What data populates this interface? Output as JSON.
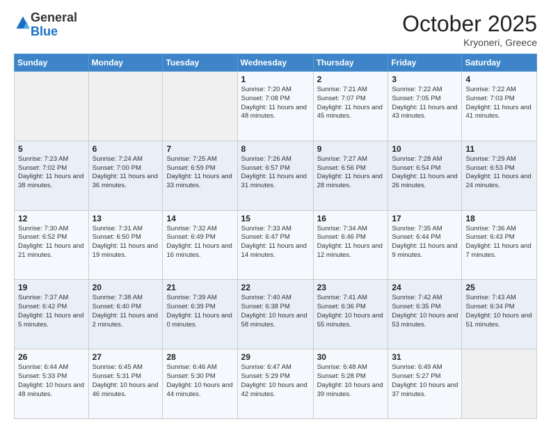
{
  "logo": {
    "general": "General",
    "blue": "Blue"
  },
  "header": {
    "month": "October 2025",
    "location": "Kryoneri, Greece"
  },
  "days_of_week": [
    "Sunday",
    "Monday",
    "Tuesday",
    "Wednesday",
    "Thursday",
    "Friday",
    "Saturday"
  ],
  "weeks": [
    [
      {
        "day": "",
        "info": ""
      },
      {
        "day": "",
        "info": ""
      },
      {
        "day": "",
        "info": ""
      },
      {
        "day": "1",
        "info": "Sunrise: 7:20 AM\nSunset: 7:08 PM\nDaylight: 11 hours\nand 48 minutes."
      },
      {
        "day": "2",
        "info": "Sunrise: 7:21 AM\nSunset: 7:07 PM\nDaylight: 11 hours\nand 45 minutes."
      },
      {
        "day": "3",
        "info": "Sunrise: 7:22 AM\nSunset: 7:05 PM\nDaylight: 11 hours\nand 43 minutes."
      },
      {
        "day": "4",
        "info": "Sunrise: 7:22 AM\nSunset: 7:03 PM\nDaylight: 11 hours\nand 41 minutes."
      }
    ],
    [
      {
        "day": "5",
        "info": "Sunrise: 7:23 AM\nSunset: 7:02 PM\nDaylight: 11 hours\nand 38 minutes."
      },
      {
        "day": "6",
        "info": "Sunrise: 7:24 AM\nSunset: 7:00 PM\nDaylight: 11 hours\nand 36 minutes."
      },
      {
        "day": "7",
        "info": "Sunrise: 7:25 AM\nSunset: 6:59 PM\nDaylight: 11 hours\nand 33 minutes."
      },
      {
        "day": "8",
        "info": "Sunrise: 7:26 AM\nSunset: 6:57 PM\nDaylight: 11 hours\nand 31 minutes."
      },
      {
        "day": "9",
        "info": "Sunrise: 7:27 AM\nSunset: 6:56 PM\nDaylight: 11 hours\nand 28 minutes."
      },
      {
        "day": "10",
        "info": "Sunrise: 7:28 AM\nSunset: 6:54 PM\nDaylight: 11 hours\nand 26 minutes."
      },
      {
        "day": "11",
        "info": "Sunrise: 7:29 AM\nSunset: 6:53 PM\nDaylight: 11 hours\nand 24 minutes."
      }
    ],
    [
      {
        "day": "12",
        "info": "Sunrise: 7:30 AM\nSunset: 6:52 PM\nDaylight: 11 hours\nand 21 minutes."
      },
      {
        "day": "13",
        "info": "Sunrise: 7:31 AM\nSunset: 6:50 PM\nDaylight: 11 hours\nand 19 minutes."
      },
      {
        "day": "14",
        "info": "Sunrise: 7:32 AM\nSunset: 6:49 PM\nDaylight: 11 hours\nand 16 minutes."
      },
      {
        "day": "15",
        "info": "Sunrise: 7:33 AM\nSunset: 6:47 PM\nDaylight: 11 hours\nand 14 minutes."
      },
      {
        "day": "16",
        "info": "Sunrise: 7:34 AM\nSunset: 6:46 PM\nDaylight: 11 hours\nand 12 minutes."
      },
      {
        "day": "17",
        "info": "Sunrise: 7:35 AM\nSunset: 6:44 PM\nDaylight: 11 hours\nand 9 minutes."
      },
      {
        "day": "18",
        "info": "Sunrise: 7:36 AM\nSunset: 6:43 PM\nDaylight: 11 hours\nand 7 minutes."
      }
    ],
    [
      {
        "day": "19",
        "info": "Sunrise: 7:37 AM\nSunset: 6:42 PM\nDaylight: 11 hours\nand 5 minutes."
      },
      {
        "day": "20",
        "info": "Sunrise: 7:38 AM\nSunset: 6:40 PM\nDaylight: 11 hours\nand 2 minutes."
      },
      {
        "day": "21",
        "info": "Sunrise: 7:39 AM\nSunset: 6:39 PM\nDaylight: 11 hours\nand 0 minutes."
      },
      {
        "day": "22",
        "info": "Sunrise: 7:40 AM\nSunset: 6:38 PM\nDaylight: 10 hours\nand 58 minutes."
      },
      {
        "day": "23",
        "info": "Sunrise: 7:41 AM\nSunset: 6:36 PM\nDaylight: 10 hours\nand 55 minutes."
      },
      {
        "day": "24",
        "info": "Sunrise: 7:42 AM\nSunset: 6:35 PM\nDaylight: 10 hours\nand 53 minutes."
      },
      {
        "day": "25",
        "info": "Sunrise: 7:43 AM\nSunset: 6:34 PM\nDaylight: 10 hours\nand 51 minutes."
      }
    ],
    [
      {
        "day": "26",
        "info": "Sunrise: 6:44 AM\nSunset: 5:33 PM\nDaylight: 10 hours\nand 48 minutes."
      },
      {
        "day": "27",
        "info": "Sunrise: 6:45 AM\nSunset: 5:31 PM\nDaylight: 10 hours\nand 46 minutes."
      },
      {
        "day": "28",
        "info": "Sunrise: 6:46 AM\nSunset: 5:30 PM\nDaylight: 10 hours\nand 44 minutes."
      },
      {
        "day": "29",
        "info": "Sunrise: 6:47 AM\nSunset: 5:29 PM\nDaylight: 10 hours\nand 42 minutes."
      },
      {
        "day": "30",
        "info": "Sunrise: 6:48 AM\nSunset: 5:28 PM\nDaylight: 10 hours\nand 39 minutes."
      },
      {
        "day": "31",
        "info": "Sunrise: 6:49 AM\nSunset: 5:27 PM\nDaylight: 10 hours\nand 37 minutes."
      },
      {
        "day": "",
        "info": ""
      }
    ]
  ]
}
